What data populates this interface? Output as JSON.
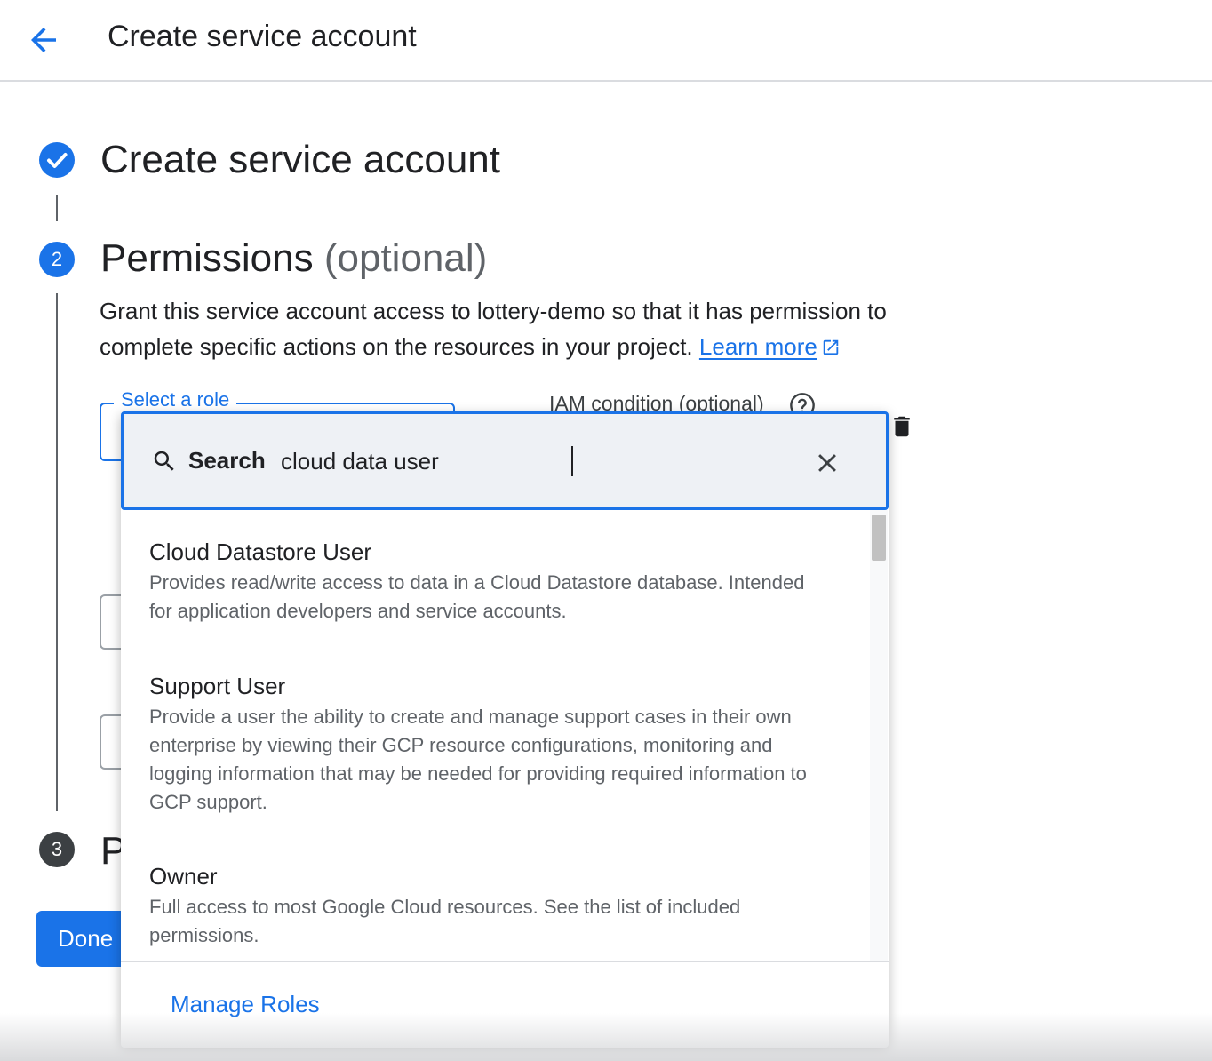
{
  "header": {
    "title": "Create service account"
  },
  "steps": [
    {
      "number": "",
      "title": "Create service account"
    },
    {
      "number": "2",
      "title": "Permissions",
      "suffix": "(optional)"
    },
    {
      "number": "3",
      "title": "P"
    }
  ],
  "permissions": {
    "description": "Grant this service account access to lottery-demo so that it has permission to complete specific actions on the resources in your project.",
    "learn_more": "Learn more",
    "role_label": "Select a role",
    "iam_condition_label": "IAM condition (optional)"
  },
  "done_button": "Done",
  "dropdown": {
    "search_label": "Search",
    "search_value": "cloud data user",
    "options": [
      {
        "title": "Cloud Datastore User",
        "description": "Provides read/write access to data in a Cloud Datastore database. Intended for application developers and service accounts."
      },
      {
        "title": "Support User",
        "description": "Provide a user the ability to create and manage support cases in their own enterprise by viewing their GCP resource configurations, monitoring and logging information that may be needed for providing required information to GCP support."
      },
      {
        "title": "Owner",
        "description": "Full access to most Google Cloud resources. See the list of included permissions."
      }
    ],
    "manage_roles": "Manage Roles"
  },
  "colors": {
    "accent": "#1a73e8",
    "step_inactive": "#5f6368",
    "text": "#202124",
    "secondary_text": "#5f6368"
  },
  "icons": [
    "arrow-back-icon",
    "check-circle-icon",
    "help-icon",
    "delete-icon",
    "search-icon",
    "close-icon",
    "open-in-new-icon"
  ]
}
